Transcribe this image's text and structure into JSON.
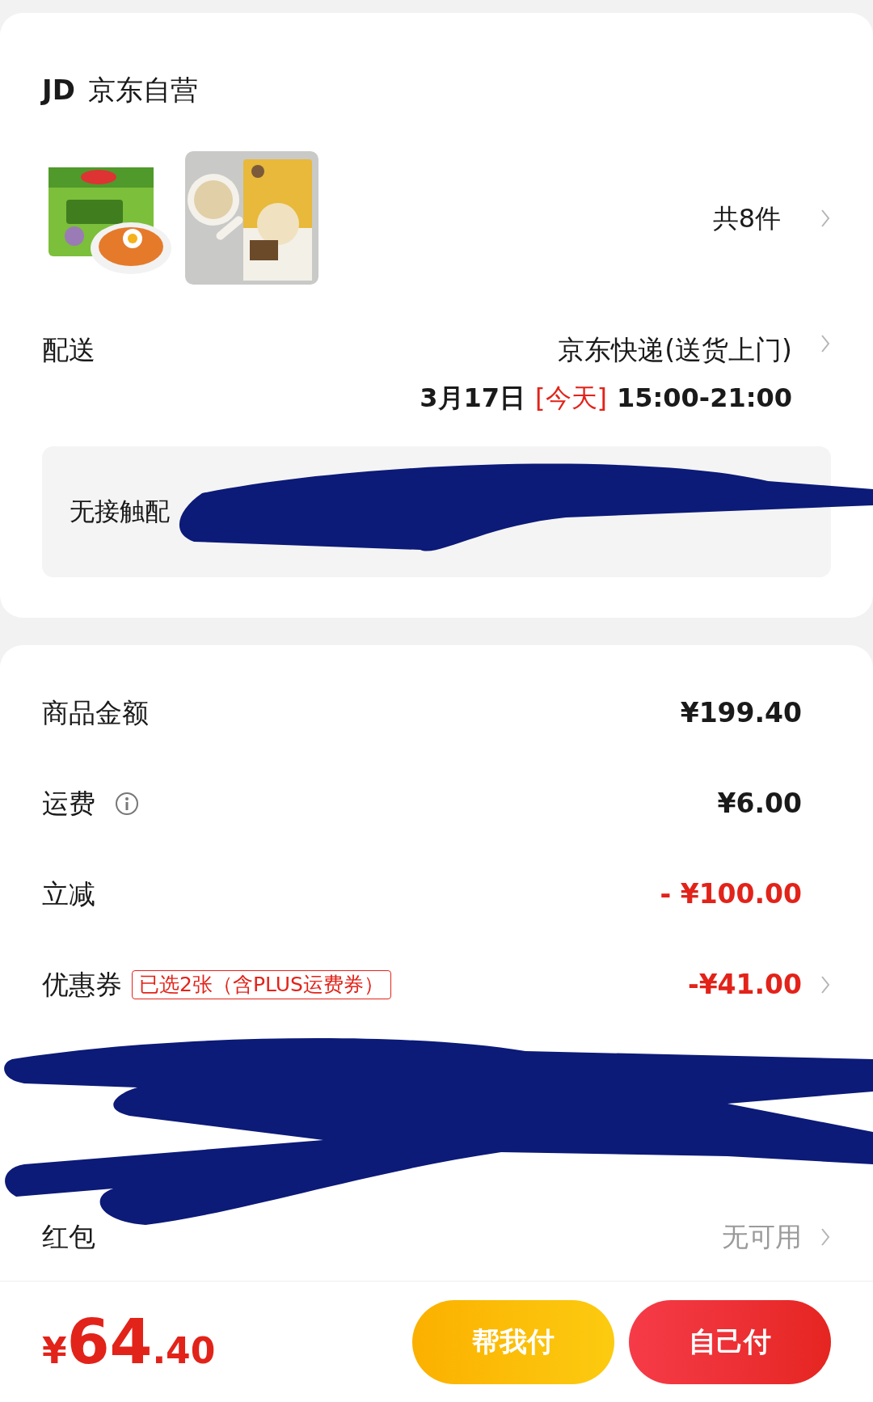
{
  "shop": {
    "logo": "JD",
    "name": "京东自营"
  },
  "item_count": "共8件",
  "delivery": {
    "label": "配送",
    "method": "京东快递(送货上门)",
    "date": "3月17日",
    "day_tag": "[今天]",
    "time": "15:00-21:00"
  },
  "note": {
    "text": "无接触配"
  },
  "fees": [
    {
      "kind": "amount",
      "label": "商品金额",
      "value": "¥199.40"
    },
    {
      "kind": "info",
      "label": "运费",
      "value": "¥6.00"
    },
    {
      "kind": "discount",
      "label": "立减",
      "value": "- ¥100.00"
    },
    {
      "kind": "coupon",
      "label": "优惠券",
      "tag": "已选2张（含PLUS运费券）",
      "value": "-¥41.00"
    },
    {
      "kind": "none",
      "label": "红包",
      "value": "无可用"
    }
  ],
  "total": {
    "symbol": "¥",
    "integer": "64",
    "decimal": ".40"
  },
  "buttons": [
    {
      "kind": "secondary",
      "label": "帮我付"
    },
    {
      "kind": "primary",
      "label": "自己付"
    }
  ]
}
